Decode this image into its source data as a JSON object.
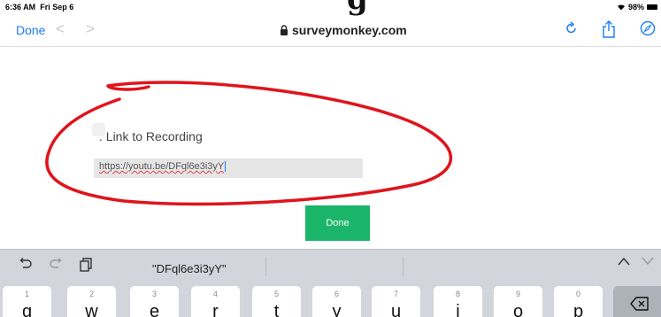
{
  "status_bar": {
    "time": "6:36 AM",
    "date": "Fri Sep 6",
    "battery": "98%"
  },
  "nav": {
    "done": "Done",
    "back": "<",
    "forward": ">",
    "url": "surveymonkey.com"
  },
  "cropped_heading": "g",
  "form": {
    "label": ". Link to Recording",
    "input_value": "https://youtu.be/DFql6e3i3yY",
    "submit": "Done"
  },
  "keyboard": {
    "suggestion": "\"DFql6e3i3yY\"",
    "keys": [
      {
        "num": "1",
        "letter": "q"
      },
      {
        "num": "2",
        "letter": "w"
      },
      {
        "num": "3",
        "letter": "e"
      },
      {
        "num": "4",
        "letter": "r"
      },
      {
        "num": "5",
        "letter": "t"
      },
      {
        "num": "6",
        "letter": "y"
      },
      {
        "num": "7",
        "letter": "u"
      },
      {
        "num": "8",
        "letter": "i"
      },
      {
        "num": "9",
        "letter": "o"
      },
      {
        "num": "0",
        "letter": "p"
      }
    ]
  },
  "colors": {
    "accent": "#1a7ef5",
    "done_green": "#1bb56a",
    "annotation_red": "#e0141c"
  }
}
